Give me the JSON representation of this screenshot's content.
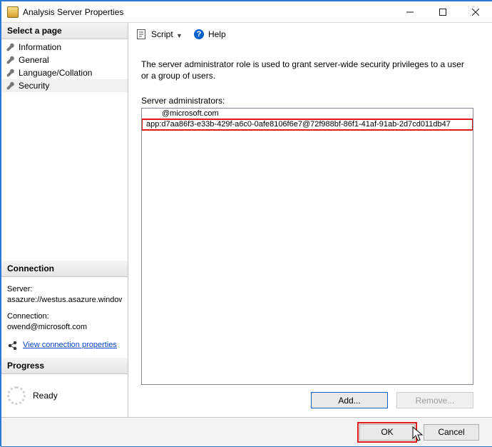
{
  "window": {
    "title": "Analysis Server Properties"
  },
  "sidebar": {
    "select_header": "Select a page",
    "pages": [
      "Information",
      "General",
      "Language/Collation",
      "Security"
    ],
    "selected_index": 3,
    "connection_header": "Connection",
    "server_label": "Server:",
    "server_value": "asazure://westus.asazure.windows",
    "connection_label": "Connection:",
    "connection_value": "owend@microsoft.com",
    "view_props_link": "View connection properties",
    "progress_header": "Progress",
    "progress_text": "Ready"
  },
  "toolbar": {
    "script_label": "Script",
    "help_label": "Help"
  },
  "main": {
    "description": "The server administrator role is used to grant server-wide security privileges to a user or a group of users.",
    "list_label": "Server administrators:",
    "admins": [
      "@microsoft.com",
      "app:d7aa86f3-e33b-429f-a6c0-0afe8106f6e7@72f988bf-86f1-41af-91ab-2d7cd011db47"
    ],
    "highlight_index": 1,
    "add_label": "Add...",
    "remove_label": "Remove..."
  },
  "footer": {
    "ok_label": "OK",
    "cancel_label": "Cancel"
  }
}
